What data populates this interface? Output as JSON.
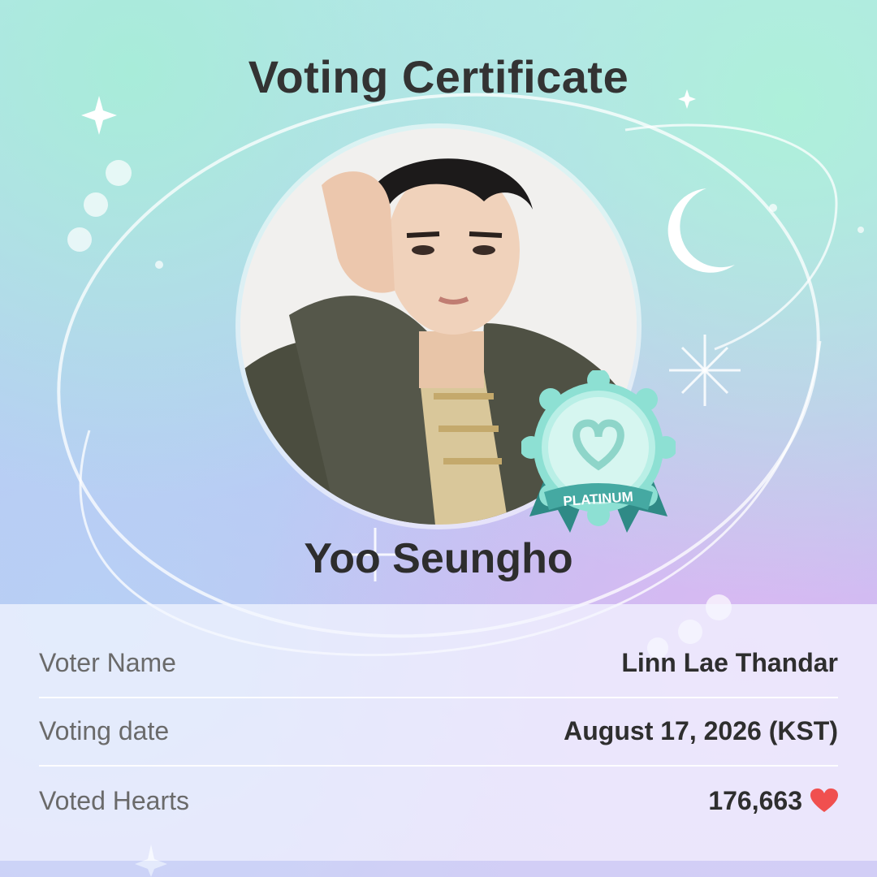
{
  "certificate": {
    "title": "Voting Certificate",
    "idol_name": "Yoo Seungho",
    "badge_label": "PLATINUM"
  },
  "details": [
    {
      "label": "Voter Name",
      "value": "Linn Lae Thandar"
    },
    {
      "label": "Voting date",
      "value": "August 17, 2026 (KST)"
    },
    {
      "label": "Voted Hearts",
      "value": "176,663"
    }
  ],
  "icons": {
    "heart": "heart-icon",
    "moon": "crescent-moon-icon",
    "sparkle": "sparkle-icon"
  },
  "colors": {
    "badge_teal": "#7fd9cc",
    "badge_dark": "#2f8a86",
    "heart_red": "#f0504f",
    "title_text": "#333333"
  }
}
